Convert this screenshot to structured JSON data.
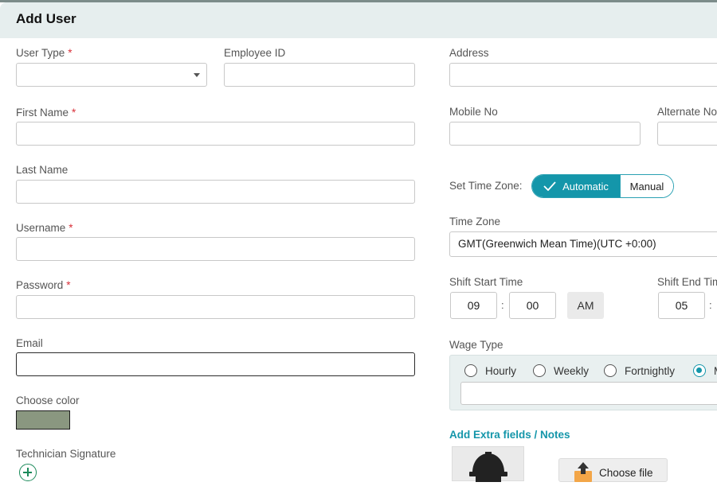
{
  "dialog": {
    "title": "Add User"
  },
  "left": {
    "user_type": {
      "label": "User Type",
      "required": "*",
      "value": ""
    },
    "employee_id": {
      "label": "Employee ID",
      "value": ""
    },
    "first_name": {
      "label": "First Name",
      "required": "*",
      "value": ""
    },
    "last_name": {
      "label": "Last Name",
      "value": ""
    },
    "username": {
      "label": "Username",
      "required": "*",
      "value": ""
    },
    "password": {
      "label": "Password",
      "required": "*",
      "value": ""
    },
    "email": {
      "label": "Email",
      "value": ""
    },
    "choose_color": {
      "label": "Choose color",
      "value": "#8a9780"
    },
    "technician_signature": {
      "label": "Technician Signature"
    }
  },
  "right": {
    "address": {
      "label": "Address",
      "value": ""
    },
    "mobile_no": {
      "label": "Mobile No",
      "value": ""
    },
    "alternate_no": {
      "label": "Alternate No",
      "value": ""
    },
    "set_time_zone": {
      "label": "Set Time Zone:",
      "options": [
        "Automatic",
        "Manual"
      ],
      "selected": "Automatic"
    },
    "time_zone": {
      "label": "Time Zone",
      "value": "GMT(Greenwich Mean Time)(UTC +0:00)"
    },
    "shift_start": {
      "label": "Shift Start Time",
      "hour": "09",
      "minute": "00",
      "period": "AM",
      "separator": ":"
    },
    "shift_end": {
      "label": "Shift End Time",
      "hour": "05",
      "separator": ":"
    },
    "wage_type": {
      "label": "Wage Type",
      "options": [
        "Hourly",
        "Weekly",
        "Fortnightly",
        "M"
      ],
      "selected": "M"
    },
    "extra_fields_link": "Add Extra fields / Notes",
    "choose_file": "Choose file"
  },
  "colors": {
    "accent": "#1496aa",
    "required": "#d9313a",
    "header_bg": "#e6eeee",
    "add_icon": "#1b8a5a"
  },
  "icons": [
    "chevron-down-icon",
    "check-icon",
    "plus-circle-icon",
    "hard-hat-icon",
    "upload-icon"
  ]
}
